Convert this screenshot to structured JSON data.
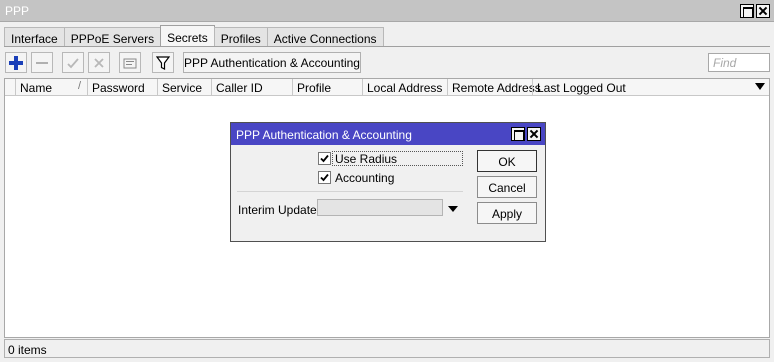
{
  "window": {
    "title": "PPP"
  },
  "tabs": [
    {
      "label": "Interface",
      "active": false
    },
    {
      "label": "PPPoE Servers",
      "active": false
    },
    {
      "label": "Secrets",
      "active": true
    },
    {
      "label": "Profiles",
      "active": false
    },
    {
      "label": "Active Connections",
      "active": false
    }
  ],
  "toolbar": {
    "icons": [
      "add-icon",
      "remove-icon",
      "enable-check-icon",
      "disable-x-icon",
      "comment-icon",
      "filter-icon"
    ],
    "ppp_auth_button": "PPP Authentication & Accounting",
    "find_placeholder": "Find"
  },
  "table": {
    "columns": [
      "Name",
      "Password",
      "Service",
      "Caller ID",
      "Profile",
      "Local Address",
      "Remote Address",
      "Last Logged Out"
    ],
    "sort_indicator": "/",
    "rows": []
  },
  "status": {
    "items": "0 items"
  },
  "dialog": {
    "title": "PPP Authentication & Accounting",
    "use_radius": {
      "label": "Use Radius",
      "checked": true
    },
    "accounting": {
      "label": "Accounting",
      "checked": true
    },
    "interim_update": {
      "label": "Interim Update:",
      "value": ""
    },
    "buttons": {
      "ok": "OK",
      "cancel": "Cancel",
      "apply": "Apply"
    }
  },
  "colors": {
    "title_bar": "#c4c4c4",
    "dialog_title_bar": "#4946c4",
    "add_icon": "#1a3fb8"
  }
}
